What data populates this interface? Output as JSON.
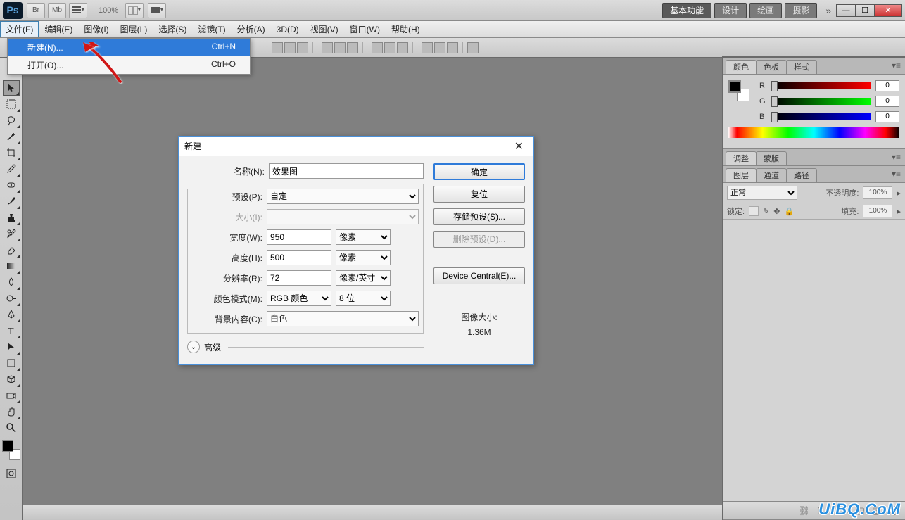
{
  "topChrome": {
    "appLogo": "Ps",
    "iconBtn1": "Br",
    "iconBtn2": "Mb",
    "zoom": "100%",
    "workspaces": [
      {
        "label": "基本功能",
        "active": true
      },
      {
        "label": "设计"
      },
      {
        "label": "绘画"
      },
      {
        "label": "摄影"
      }
    ]
  },
  "menuBar": [
    {
      "label": "文件(F)",
      "active": true
    },
    {
      "label": "编辑(E)"
    },
    {
      "label": "图像(I)"
    },
    {
      "label": "图层(L)"
    },
    {
      "label": "选择(S)"
    },
    {
      "label": "滤镜(T)"
    },
    {
      "label": "分析(A)"
    },
    {
      "label": "3D(D)"
    },
    {
      "label": "视图(V)"
    },
    {
      "label": "窗口(W)"
    },
    {
      "label": "帮助(H)"
    }
  ],
  "fileMenu": {
    "items": [
      {
        "label": "新建(N)...",
        "shortcut": "Ctrl+N",
        "highlight": true
      },
      {
        "label": "打开(O)...",
        "shortcut": "Ctrl+O"
      }
    ]
  },
  "dialog": {
    "title": "新建",
    "fields": {
      "name": {
        "label": "名称(N):",
        "value": "效果图"
      },
      "preset": {
        "label": "预设(P):",
        "value": "自定"
      },
      "size": {
        "label": "大小(I):",
        "value": ""
      },
      "width": {
        "label": "宽度(W):",
        "value": "950",
        "unit": "像素"
      },
      "height": {
        "label": "高度(H):",
        "value": "500",
        "unit": "像素"
      },
      "resolution": {
        "label": "分辨率(R):",
        "value": "72",
        "unit": "像素/英寸"
      },
      "colorMode": {
        "label": "颜色模式(M):",
        "value": "RGB 颜色",
        "depth": "8 位"
      },
      "bgContents": {
        "label": "背景内容(C):",
        "value": "白色"
      }
    },
    "advanced": "高级",
    "buttons": {
      "ok": "确定",
      "reset": "复位",
      "savePreset": "存储预设(S)...",
      "deletePreset": "删除预设(D)...",
      "deviceCentral": "Device Central(E)..."
    },
    "imageSize": {
      "label": "图像大小:",
      "value": "1.36M"
    }
  },
  "colorPanel": {
    "tabs": [
      "颜色",
      "色板",
      "样式"
    ],
    "r": {
      "label": "R",
      "value": "0"
    },
    "g": {
      "label": "G",
      "value": "0"
    },
    "b": {
      "label": "B",
      "value": "0"
    }
  },
  "adjustPanel": {
    "tabs": [
      "调整",
      "蒙版"
    ]
  },
  "layersPanel": {
    "tabs": [
      "图层",
      "通道",
      "路径"
    ],
    "blendMode": "正常",
    "opacityLabel": "不透明度:",
    "opacity": "100%",
    "lockLabel": "锁定:",
    "fillLabel": "填充:",
    "fill": "100%"
  },
  "watermark": "UiBQ.CoM"
}
